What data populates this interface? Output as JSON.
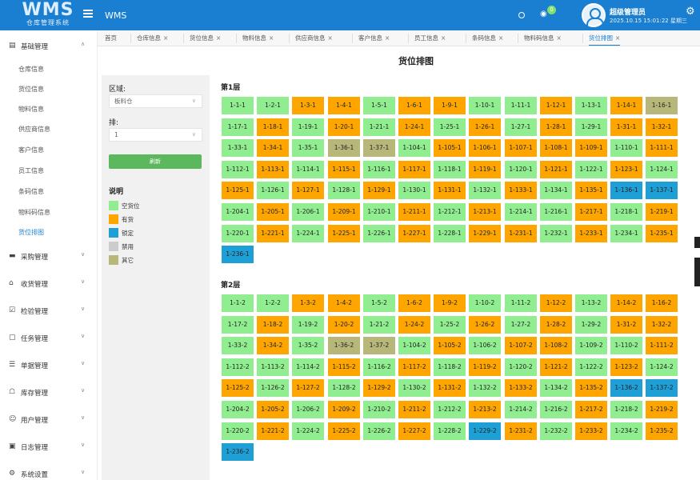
{
  "header": {
    "logo_mark": "WMS",
    "logo_sub": "仓库管理系统",
    "app_title": "WMS",
    "notification_count": "0",
    "user_name": "超级管理员",
    "user_time": "2025.10.15 15:01:22 星期三"
  },
  "sidebar": {
    "groups": [
      {
        "label": "基础管理",
        "icon": "folder-icon",
        "expanded": true
      },
      {
        "label": "采购管理",
        "icon": "cart-icon"
      },
      {
        "label": "收货管理",
        "icon": "home-icon"
      },
      {
        "label": "检验管理",
        "icon": "check-icon"
      },
      {
        "label": "任务管理",
        "icon": "task-icon"
      },
      {
        "label": "单据管理",
        "icon": "document-icon"
      },
      {
        "label": "库存管理",
        "icon": "warehouse-icon"
      },
      {
        "label": "用户管理",
        "icon": "user-icon"
      },
      {
        "label": "日志管理",
        "icon": "log-icon"
      },
      {
        "label": "系统设置",
        "icon": "settings-icon"
      }
    ],
    "sub_items": [
      "仓库信息",
      "货位信息",
      "物料信息",
      "供应商信息",
      "客户信息",
      "员工信息",
      "条码信息",
      "物料码信息",
      "货位排图"
    ],
    "active_sub": "货位排图"
  },
  "tabs": [
    {
      "label": "首页",
      "closable": false
    },
    {
      "label": "仓库信息",
      "closable": true
    },
    {
      "label": "货位信息",
      "closable": true
    },
    {
      "label": "物料信息",
      "closable": true
    },
    {
      "label": "供应商信息",
      "closable": true
    },
    {
      "label": "客户信息",
      "closable": true
    },
    {
      "label": "员工信息",
      "closable": true
    },
    {
      "label": "条码信息",
      "closable": true
    },
    {
      "label": "物料码信息",
      "closable": true
    },
    {
      "label": "货位排图",
      "closable": true,
      "active": true
    }
  ],
  "page": {
    "title": "货位排图",
    "area_label": "区域:",
    "area_value": "板料仓",
    "row_label": "排:",
    "row_value": "1",
    "refresh_label": "刷新",
    "legend_title": "说明"
  },
  "legend": [
    {
      "label": "空货位",
      "status": "empty",
      "color": "#90ee90"
    },
    {
      "label": "有货",
      "status": "stocked",
      "color": "#ffa500"
    },
    {
      "label": "锁定",
      "status": "locked",
      "color": "#1e9fd6"
    },
    {
      "label": "禁用",
      "status": "disabled",
      "color": "#cccccc"
    },
    {
      "label": "其它",
      "status": "other",
      "color": "#b8b77a"
    }
  ],
  "status_colors": {
    "E": "#90ee90",
    "S": "#ffa500",
    "L": "#1e9fd6",
    "D": "#cccccc",
    "O": "#b8b77a"
  },
  "layers": [
    {
      "title": "第1层",
      "cells": [
        [
          "1-1-1",
          "E"
        ],
        [
          "1-2-1",
          "E"
        ],
        [
          "1-3-1",
          "S"
        ],
        [
          "1-4-1",
          "S"
        ],
        [
          "1-5-1",
          "E"
        ],
        [
          "1-6-1",
          "S"
        ],
        [
          "1-9-1",
          "S"
        ],
        [
          "1-10-1",
          "E"
        ],
        [
          "1-11-1",
          "E"
        ],
        [
          "1-12-1",
          "S"
        ],
        [
          "1-13-1",
          "E"
        ],
        [
          "1-14-1",
          "S"
        ],
        [
          "1-16-1",
          "O"
        ],
        [
          "1-17-1",
          "E"
        ],
        [
          "1-18-1",
          "S"
        ],
        [
          "1-19-1",
          "E"
        ],
        [
          "1-20-1",
          "S"
        ],
        [
          "1-21-1",
          "E"
        ],
        [
          "1-24-1",
          "S"
        ],
        [
          "1-25-1",
          "E"
        ],
        [
          "1-26-1",
          "S"
        ],
        [
          "1-27-1",
          "E"
        ],
        [
          "1-28-1",
          "S"
        ],
        [
          "1-29-1",
          "E"
        ],
        [
          "1-31-1",
          "S"
        ],
        [
          "1-32-1",
          "S"
        ],
        [
          "1-33-1",
          "E"
        ],
        [
          "1-34-1",
          "S"
        ],
        [
          "1-35-1",
          "E"
        ],
        [
          "1-36-1",
          "O"
        ],
        [
          "1-37-1",
          "O"
        ],
        [
          "1-104-1",
          "E"
        ],
        [
          "1-105-1",
          "S"
        ],
        [
          "1-106-1",
          "S"
        ],
        [
          "1-107-1",
          "S"
        ],
        [
          "1-108-1",
          "S"
        ],
        [
          "1-109-1",
          "S"
        ],
        [
          "1-110-1",
          "E"
        ],
        [
          "1-111-1",
          "S"
        ],
        [
          "1-112-1",
          "E"
        ],
        [
          "1-113-1",
          "S"
        ],
        [
          "1-114-1",
          "E"
        ],
        [
          "1-115-1",
          "S"
        ],
        [
          "1-116-1",
          "E"
        ],
        [
          "1-117-1",
          "S"
        ],
        [
          "1-118-1",
          "E"
        ],
        [
          "1-119-1",
          "S"
        ],
        [
          "1-120-1",
          "E"
        ],
        [
          "1-121-1",
          "S"
        ],
        [
          "1-122-1",
          "E"
        ],
        [
          "1-123-1",
          "S"
        ],
        [
          "1-124-1",
          "E"
        ],
        [
          "1-125-1",
          "S"
        ],
        [
          "1-126-1",
          "E"
        ],
        [
          "1-127-1",
          "S"
        ],
        [
          "1-128-1",
          "E"
        ],
        [
          "1-129-1",
          "S"
        ],
        [
          "1-130-1",
          "E"
        ],
        [
          "1-131-1",
          "S"
        ],
        [
          "1-132-1",
          "E"
        ],
        [
          "1-133-1",
          "S"
        ],
        [
          "1-134-1",
          "E"
        ],
        [
          "1-135-1",
          "S"
        ],
        [
          "1-136-1",
          "L"
        ],
        [
          "1-137-1",
          "L"
        ],
        [
          "1-204-1",
          "E"
        ],
        [
          "1-205-1",
          "S"
        ],
        [
          "1-206-1",
          "E"
        ],
        [
          "1-209-1",
          "S"
        ],
        [
          "1-210-1",
          "E"
        ],
        [
          "1-211-1",
          "S"
        ],
        [
          "1-212-1",
          "E"
        ],
        [
          "1-213-1",
          "S"
        ],
        [
          "1-214-1",
          "E"
        ],
        [
          "1-216-1",
          "E"
        ],
        [
          "1-217-1",
          "S"
        ],
        [
          "1-218-1",
          "E"
        ],
        [
          "1-219-1",
          "S"
        ],
        [
          "1-220-1",
          "E"
        ],
        [
          "1-221-1",
          "S"
        ],
        [
          "1-224-1",
          "E"
        ],
        [
          "1-225-1",
          "S"
        ],
        [
          "1-226-1",
          "E"
        ],
        [
          "1-227-1",
          "S"
        ],
        [
          "1-228-1",
          "E"
        ],
        [
          "1-229-1",
          "S"
        ],
        [
          "1-231-1",
          "S"
        ],
        [
          "1-232-1",
          "E"
        ],
        [
          "1-233-1",
          "S"
        ],
        [
          "1-234-1",
          "E"
        ],
        [
          "1-235-1",
          "S"
        ],
        [
          "1-236-1",
          "L"
        ]
      ]
    },
    {
      "title": "第2层",
      "cells": [
        [
          "1-1-2",
          "E"
        ],
        [
          "1-2-2",
          "E"
        ],
        [
          "1-3-2",
          "S"
        ],
        [
          "1-4-2",
          "S"
        ],
        [
          "1-5-2",
          "E"
        ],
        [
          "1-6-2",
          "S"
        ],
        [
          "1-9-2",
          "S"
        ],
        [
          "1-10-2",
          "E"
        ],
        [
          "1-11-2",
          "E"
        ],
        [
          "1-12-2",
          "S"
        ],
        [
          "1-13-2",
          "E"
        ],
        [
          "1-14-2",
          "S"
        ],
        [
          "1-16-2",
          "S"
        ],
        [
          "1-17-2",
          "E"
        ],
        [
          "1-18-2",
          "S"
        ],
        [
          "1-19-2",
          "E"
        ],
        [
          "1-20-2",
          "S"
        ],
        [
          "1-21-2",
          "E"
        ],
        [
          "1-24-2",
          "S"
        ],
        [
          "1-25-2",
          "E"
        ],
        [
          "1-26-2",
          "S"
        ],
        [
          "1-27-2",
          "E"
        ],
        [
          "1-28-2",
          "S"
        ],
        [
          "1-29-2",
          "E"
        ],
        [
          "1-31-2",
          "S"
        ],
        [
          "1-32-2",
          "S"
        ],
        [
          "1-33-2",
          "E"
        ],
        [
          "1-34-2",
          "S"
        ],
        [
          "1-35-2",
          "E"
        ],
        [
          "1-36-2",
          "O"
        ],
        [
          "1-37-2",
          "O"
        ],
        [
          "1-104-2",
          "E"
        ],
        [
          "1-105-2",
          "S"
        ],
        [
          "1-106-2",
          "E"
        ],
        [
          "1-107-2",
          "S"
        ],
        [
          "1-108-2",
          "S"
        ],
        [
          "1-109-2",
          "E"
        ],
        [
          "1-110-2",
          "E"
        ],
        [
          "1-111-2",
          "S"
        ],
        [
          "1-112-2",
          "E"
        ],
        [
          "1-113-2",
          "E"
        ],
        [
          "1-114-2",
          "E"
        ],
        [
          "1-115-2",
          "S"
        ],
        [
          "1-116-2",
          "E"
        ],
        [
          "1-117-2",
          "S"
        ],
        [
          "1-118-2",
          "E"
        ],
        [
          "1-119-2",
          "S"
        ],
        [
          "1-120-2",
          "E"
        ],
        [
          "1-121-2",
          "S"
        ],
        [
          "1-122-2",
          "E"
        ],
        [
          "1-123-2",
          "S"
        ],
        [
          "1-124-2",
          "E"
        ],
        [
          "1-125-2",
          "S"
        ],
        [
          "1-126-2",
          "E"
        ],
        [
          "1-127-2",
          "S"
        ],
        [
          "1-128-2",
          "E"
        ],
        [
          "1-129-2",
          "S"
        ],
        [
          "1-130-2",
          "E"
        ],
        [
          "1-131-2",
          "S"
        ],
        [
          "1-132-2",
          "E"
        ],
        [
          "1-133-2",
          "S"
        ],
        [
          "1-134-2",
          "E"
        ],
        [
          "1-135-2",
          "S"
        ],
        [
          "1-136-2",
          "L"
        ],
        [
          "1-137-2",
          "L"
        ],
        [
          "1-204-2",
          "E"
        ],
        [
          "1-205-2",
          "S"
        ],
        [
          "1-206-2",
          "E"
        ],
        [
          "1-209-2",
          "S"
        ],
        [
          "1-210-2",
          "E"
        ],
        [
          "1-211-2",
          "S"
        ],
        [
          "1-212-2",
          "E"
        ],
        [
          "1-213-2",
          "S"
        ],
        [
          "1-214-2",
          "E"
        ],
        [
          "1-216-2",
          "E"
        ],
        [
          "1-217-2",
          "S"
        ],
        [
          "1-218-2",
          "E"
        ],
        [
          "1-219-2",
          "S"
        ],
        [
          "1-220-2",
          "E"
        ],
        [
          "1-221-2",
          "S"
        ],
        [
          "1-224-2",
          "E"
        ],
        [
          "1-225-2",
          "S"
        ],
        [
          "1-226-2",
          "E"
        ],
        [
          "1-227-2",
          "S"
        ],
        [
          "1-228-2",
          "E"
        ],
        [
          "1-229-2",
          "L"
        ],
        [
          "1-231-2",
          "S"
        ],
        [
          "1-232-2",
          "E"
        ],
        [
          "1-233-2",
          "S"
        ],
        [
          "1-234-2",
          "E"
        ],
        [
          "1-235-2",
          "S"
        ],
        [
          "1-236-2",
          "L"
        ]
      ]
    }
  ]
}
